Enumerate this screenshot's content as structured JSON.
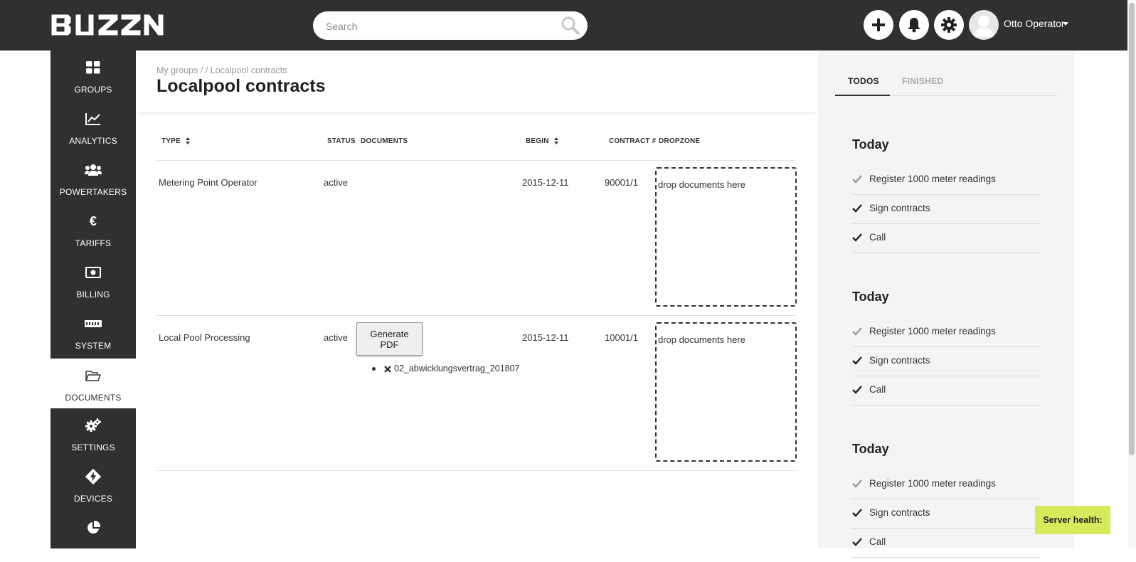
{
  "app": {
    "logo_text": "BUZZN"
  },
  "header": {
    "search_placeholder": "Search",
    "user_name": "Otto Operator",
    "icons": [
      "plus-icon",
      "bell-icon",
      "gear-icon"
    ]
  },
  "sidebar": {
    "items": [
      {
        "label": "GROUPS",
        "icon": "groups-grid-icon"
      },
      {
        "label": "ANALYTICS",
        "icon": "line-chart-icon"
      },
      {
        "label": "POWERTAKERS",
        "icon": "users-icon"
      },
      {
        "label": "TARIFFS",
        "icon": "euro-icon"
      },
      {
        "label": "BILLING",
        "icon": "money-bill-icon"
      },
      {
        "label": "SYSTEM",
        "icon": "meter-icon"
      },
      {
        "label": "DOCUMENTS",
        "icon": "folder-open-icon",
        "active": true
      },
      {
        "label": "SETTINGS",
        "icon": "cogs-icon"
      },
      {
        "label": "DEVICES",
        "icon": "bolt-diamond-icon"
      },
      {
        "label": "",
        "icon": "pie-chart-icon"
      }
    ]
  },
  "page": {
    "breadcrumb": "My groups /  / Localpool contracts",
    "title": "Localpool contracts"
  },
  "table": {
    "headers": {
      "type": "TYPE",
      "status": "STATUS",
      "documents": "DOCUMENTS",
      "begin": "BEGIN",
      "contract_no": "CONTRACT #",
      "dropzone": "DROPZONE"
    },
    "rows": [
      {
        "type": "Metering Point Operator",
        "status": "active",
        "begin": "2015-12-11",
        "contract_no": "90001/1",
        "dropzone": "drop documents here"
      },
      {
        "type": "Local Pool Processing",
        "status": "active",
        "generate_label": "Generate PDF",
        "document": "02_abwicklungsvertrag_201807",
        "begin": "2015-12-11",
        "contract_no": "10001/1",
        "dropzone": "drop documents here"
      }
    ]
  },
  "todos": {
    "tabs": [
      "TODOS",
      "FINISHED"
    ],
    "groups": [
      {
        "title": "Today",
        "items": [
          "Register 1000 meter readings",
          "Sign contracts",
          "Call"
        ]
      },
      {
        "title": "Today",
        "items": [
          "Register 1000 meter readings",
          "Sign contracts",
          "Call"
        ]
      },
      {
        "title": "Today",
        "items": [
          "Register 1000 meter readings",
          "Sign contracts",
          "Call"
        ]
      }
    ]
  },
  "server_health": "Server health:",
  "colors": {
    "topbar": "#303030",
    "sidebar": "#303030",
    "accent": "#d7ea5c",
    "panel": "#f4f4f4"
  }
}
